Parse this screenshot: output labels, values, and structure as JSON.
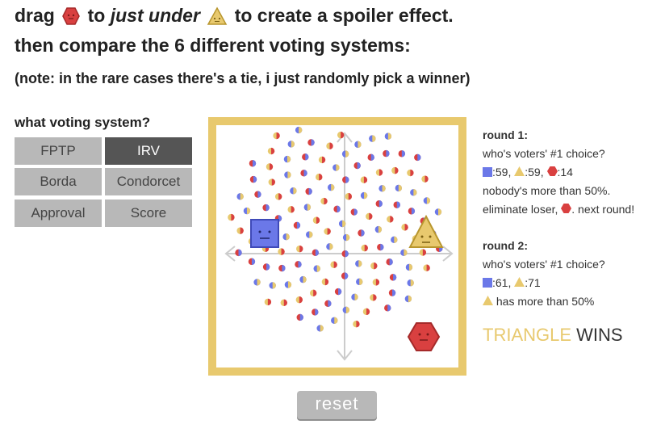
{
  "header": {
    "line1_a": "drag",
    "line1_b": "to",
    "line1_em": "just under",
    "line1_c": "to create a spoiler effect.",
    "line2": "then compare the 6 different voting systems:",
    "note": "(note: in the rare cases there's a tie, i just randomly pick a winner)"
  },
  "voting": {
    "title": "what voting system?",
    "systems": [
      "FPTP",
      "IRV",
      "Borda",
      "Condorcet",
      "Approval",
      "Score"
    ],
    "selected": "IRV"
  },
  "colors": {
    "square": "#6b78e8",
    "triangle": "#e8c96e",
    "hexagon": "#d94040",
    "frame": "#e8c96e",
    "button": "#b8b8b8",
    "button_selected": "#555555"
  },
  "results": {
    "round1": {
      "heading": "round 1:",
      "question": "who's voters' #1 choice?",
      "square": ":59,",
      "triangle": ":59,",
      "hexagon": ":14",
      "line3": "nobody's more than 50%.",
      "line4a": "eliminate loser,",
      "line4b": ". next round!"
    },
    "round2": {
      "heading": "round 2:",
      "question": "who's voters' #1 choice?",
      "square": ":61,",
      "triangle": ":71",
      "line3": "has more than 50%"
    },
    "winner_name": "TRIANGLE",
    "winner_suffix": "WINS"
  },
  "reset_label": "reset"
}
